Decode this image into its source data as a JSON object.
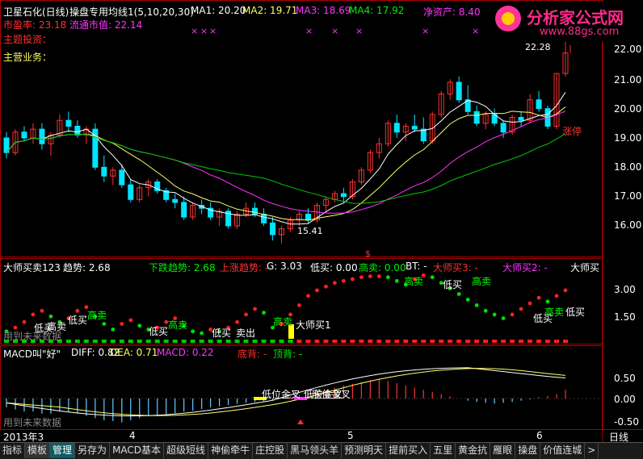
{
  "header": {
    "stock": "卫星石化(日线)",
    "ma_name": "操盘专用均线1(5,10,20,30)",
    "ma1": "MA1: 20.20",
    "ma2": "MA2: 19.71",
    "ma3": "MA3: 18.69",
    "ma4": "MA4: 17.92",
    "net_assets": "净资产: 8.40",
    "pe": "市盈率: 23.18",
    "float_cap": "流通市值: 22.14",
    "main_invest": "主题投资：",
    "main_business": "主营业务：",
    "x_marks": [
      "×",
      "×",
      "×",
      "×",
      "×",
      "×",
      "×",
      "×"
    ]
  },
  "logo": {
    "title": "分析家公式网",
    "url": "www.88gs.com"
  },
  "price_axis": [
    "22.00",
    "21.00",
    "20.00",
    "19.00",
    "18.00",
    "17.00",
    "16.00"
  ],
  "price_labels": {
    "high": "22.28",
    "low": "15.41",
    "limit": "涨停"
  },
  "indicator1": {
    "name": "大师买卖123",
    "trend": "趋势: 2.68",
    "down": "下跌趋势: 2.68",
    "up": "上涨趋势: -",
    "g": "G: 3.03",
    "low_sell": "低买: 0.00",
    "high_sell": "高卖: 0.00",
    "bt": "BT: -",
    "buy3": "大师买3: -",
    "buy2": "大师买2: -",
    "buy": "大师买",
    "axis": [
      "3.00",
      "1.50"
    ],
    "labels": [
      "低买",
      "高卖",
      "低买",
      "高卖",
      "低买",
      "高卖",
      "低买",
      "卖出",
      "高卖",
      "大师买1",
      "高卖",
      "低买",
      "高卖",
      "低买",
      "高卖",
      "低买"
    ],
    "watermark": "用到未来数据"
  },
  "macd": {
    "name": "MACD叫\"好\"",
    "diff": "DIFF: 0.82",
    "dea": "DEA: 0.71",
    "macd": "MACD: 0.22",
    "bottom_div": "底背: -",
    "top_div": "顶背: -",
    "axis": [
      "0.50",
      "0.00",
      "-0.50"
    ],
    "cross1": "低位金叉",
    "cross2": "低位金叉",
    "cross3": "压位金叉",
    "watermark": "用到未来数据"
  },
  "time_axis": {
    "year": "2013年3",
    "m4": "4",
    "m5": "5",
    "m6": "6",
    "period": "日线"
  },
  "tabs": [
    "指标",
    "模板",
    "管理",
    "另存为",
    "MACD基本",
    "超级短线",
    "神偷牵牛",
    "庄控股",
    "黑马领头羊",
    "预测明天",
    "提前买入",
    "五里",
    "黄金抗",
    "雁眼",
    "操盘",
    "价值连城",
    ">"
  ],
  "colors": {
    "up": "#ff3030",
    "down": "#00e5ff",
    "ma1": "#ffffff",
    "ma2": "#ffff66",
    "ma3": "#ff33ff",
    "ma4": "#00cc00"
  },
  "chart_data": {
    "type": "candlestick",
    "ylim": [
      15.2,
      22.4
    ],
    "candles": [
      [
        19.0,
        19.2,
        18.3,
        18.5
      ],
      [
        18.5,
        19.3,
        18.4,
        19.2
      ],
      [
        19.2,
        19.4,
        18.9,
        19.0
      ],
      [
        19.0,
        19.5,
        18.8,
        19.3
      ],
      [
        19.3,
        19.5,
        18.6,
        18.8
      ],
      [
        18.8,
        19.2,
        18.4,
        19.1
      ],
      [
        19.1,
        19.8,
        19.0,
        19.6
      ],
      [
        19.6,
        19.9,
        19.2,
        19.4
      ],
      [
        19.4,
        19.6,
        19.0,
        19.1
      ],
      [
        19.1,
        19.4,
        18.8,
        19.3
      ],
      [
        19.3,
        19.5,
        17.9,
        18.0
      ],
      [
        18.0,
        18.4,
        17.5,
        17.7
      ],
      [
        17.7,
        18.0,
        17.4,
        17.9
      ],
      [
        17.9,
        18.1,
        17.3,
        17.4
      ],
      [
        17.4,
        17.6,
        16.8,
        16.9
      ],
      [
        16.9,
        17.4,
        16.8,
        17.3
      ],
      [
        17.3,
        17.6,
        17.0,
        17.5
      ],
      [
        17.5,
        17.6,
        17.1,
        17.2
      ],
      [
        17.2,
        17.3,
        16.8,
        16.9
      ],
      [
        16.9,
        17.1,
        16.6,
        16.8
      ],
      [
        16.8,
        17.0,
        16.2,
        16.3
      ],
      [
        16.3,
        16.8,
        16.2,
        16.7
      ],
      [
        16.7,
        16.9,
        16.4,
        16.6
      ],
      [
        16.6,
        16.8,
        16.2,
        16.3
      ],
      [
        16.3,
        16.6,
        16.0,
        16.5
      ],
      [
        16.5,
        16.6,
        15.9,
        16.0
      ],
      [
        16.0,
        16.5,
        15.9,
        16.4
      ],
      [
        16.4,
        16.8,
        16.3,
        16.6
      ],
      [
        16.6,
        16.8,
        16.3,
        16.4
      ],
      [
        16.4,
        16.6,
        16.0,
        16.1
      ],
      [
        16.1,
        16.3,
        15.5,
        15.7
      ],
      [
        15.7,
        16.0,
        15.4,
        15.9
      ],
      [
        15.9,
        16.3,
        15.8,
        16.2
      ],
      [
        16.2,
        16.5,
        16.0,
        16.4
      ],
      [
        16.4,
        16.6,
        16.1,
        16.2
      ],
      [
        16.2,
        16.8,
        16.1,
        16.7
      ],
      [
        16.7,
        17.0,
        16.5,
        16.9
      ],
      [
        16.9,
        17.2,
        16.8,
        17.1
      ],
      [
        17.1,
        17.3,
        16.8,
        17.0
      ],
      [
        17.0,
        17.6,
        16.9,
        17.5
      ],
      [
        17.5,
        18.0,
        17.4,
        17.9
      ],
      [
        17.9,
        18.6,
        17.8,
        18.5
      ],
      [
        18.5,
        19.0,
        18.3,
        18.8
      ],
      [
        18.8,
        19.6,
        18.7,
        19.5
      ],
      [
        19.5,
        19.8,
        19.0,
        19.2
      ],
      [
        19.2,
        19.5,
        18.9,
        19.4
      ],
      [
        19.4,
        19.8,
        19.2,
        19.3
      ],
      [
        19.3,
        19.7,
        18.8,
        18.9
      ],
      [
        18.9,
        19.9,
        18.8,
        19.8
      ],
      [
        19.8,
        20.6,
        19.7,
        20.5
      ],
      [
        20.5,
        21.0,
        20.3,
        20.9
      ],
      [
        20.9,
        21.1,
        20.2,
        20.3
      ],
      [
        20.3,
        20.8,
        19.8,
        19.9
      ],
      [
        19.9,
        20.1,
        19.4,
        19.5
      ],
      [
        19.5,
        19.9,
        19.3,
        19.8
      ],
      [
        19.8,
        20.0,
        19.4,
        19.5
      ],
      [
        19.5,
        19.6,
        19.0,
        19.2
      ],
      [
        19.2,
        19.8,
        19.1,
        19.7
      ],
      [
        19.7,
        19.9,
        19.4,
        19.6
      ],
      [
        19.6,
        20.5,
        19.5,
        20.3
      ],
      [
        20.3,
        20.6,
        19.9,
        20.0
      ],
      [
        20.0,
        20.1,
        19.3,
        19.4
      ],
      [
        19.4,
        21.2,
        19.3,
        21.2
      ],
      [
        21.2,
        22.3,
        21.1,
        21.9
      ]
    ]
  }
}
